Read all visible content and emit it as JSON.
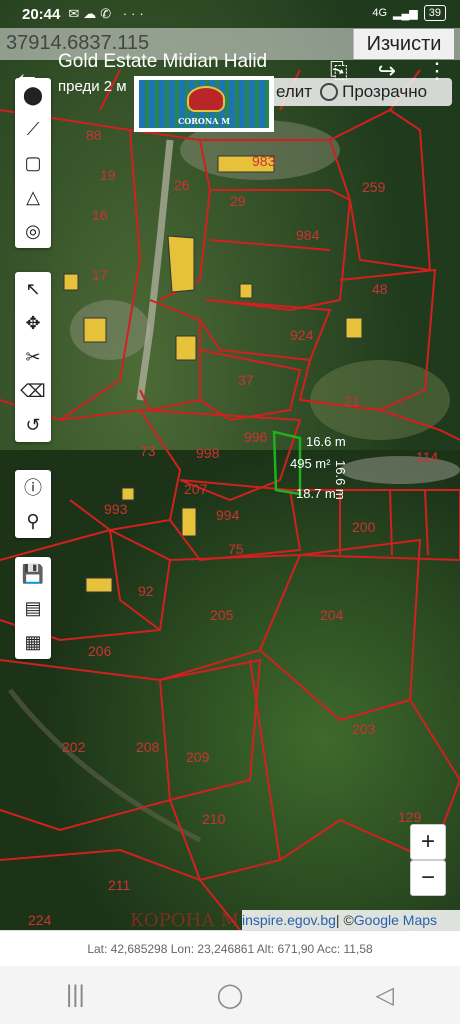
{
  "status": {
    "time": "20:44",
    "battery": "39",
    "network": "4G"
  },
  "coordinate_input": {
    "value": "37914.6837.115"
  },
  "clear_button": {
    "label": "Изчисти"
  },
  "appbar": {
    "title": "Gold Estate Midian Halid",
    "subtitle": "преди 2 м"
  },
  "map_type": {
    "satellite_label": "елит",
    "transparent_label": "Прозрачно"
  },
  "logo": {
    "text": "CORONA M"
  },
  "parcel": {
    "side_top": "16.6 m",
    "side_right": "16.6 m",
    "side_bottom": "18.7 m",
    "area": "495 m²"
  },
  "parcel_labels": [
    "983",
    "259",
    "984",
    "48",
    "924",
    "37",
    "21",
    "996",
    "114",
    "73",
    "998",
    "207",
    "994",
    "993",
    "75",
    "200",
    "92",
    "205",
    "204",
    "208",
    "209",
    "210",
    "203",
    "211",
    "224",
    "129",
    "202",
    "206",
    "29",
    "16",
    "17",
    "19",
    "88",
    "26"
  ],
  "zoom": {
    "plus": "+",
    "minus": "−"
  },
  "attribution": {
    "source": "inspire.egov.bg",
    "separator": " | © ",
    "provider": "Google Maps"
  },
  "watermark": "КОРОНА М",
  "gps": {
    "text": "Lat: 42,685298 Lon: 23,246861 Alt: 671,90 Acc: 11,58"
  },
  "colors": {
    "parcel_border": "#d22020",
    "selected_parcel": "#1fb01f",
    "building": "#e6c23a"
  }
}
